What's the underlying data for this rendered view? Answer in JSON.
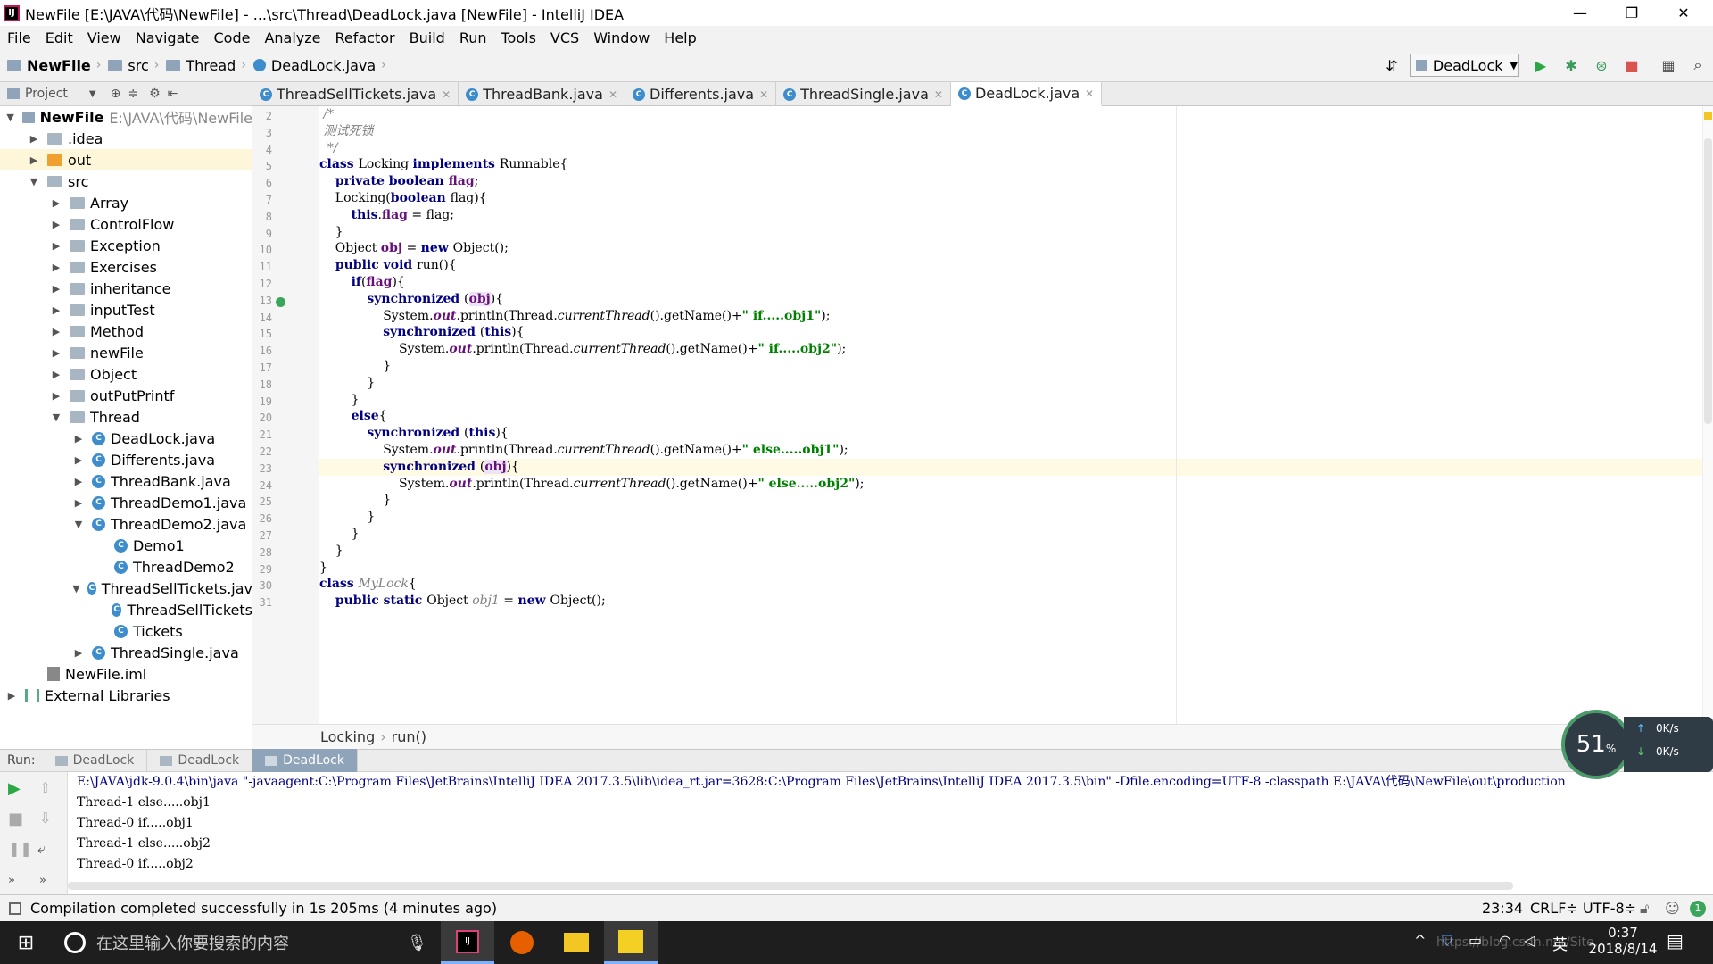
{
  "window": {
    "title": "NewFile [E:\\JAVA\\代码\\NewFile] - ...\\src\\Thread\\DeadLock.java [NewFile] - IntelliJ IDEA",
    "app_icon": "IJ"
  },
  "window_controls": {
    "minimize": "—",
    "restore": "❐",
    "close": "✕"
  },
  "menu": [
    "File",
    "Edit",
    "View",
    "Navigate",
    "Code",
    "Analyze",
    "Refactor",
    "Build",
    "Run",
    "Tools",
    "VCS",
    "Window",
    "Help"
  ],
  "breadcrumb": [
    "NewFile",
    "src",
    "Thread",
    "DeadLock.java"
  ],
  "run_config": "DeadLock",
  "project_panel": {
    "label": "Project"
  },
  "tabs": [
    {
      "label": "ThreadSellTickets.java",
      "active": false
    },
    {
      "label": "ThreadBank.java",
      "active": false
    },
    {
      "label": "Differents.java",
      "active": false
    },
    {
      "label": "ThreadSingle.java",
      "active": false
    },
    {
      "label": "DeadLock.java",
      "active": true
    }
  ],
  "tree": [
    {
      "label": "NewFile",
      "extra": "E:\\JAVA\\代码\\NewFile",
      "depth": 0,
      "arrow": "▼",
      "icon": "root",
      "bold": true
    },
    {
      "label": ".idea",
      "depth": 1,
      "arrow": "▶",
      "icon": "folder"
    },
    {
      "label": "out",
      "depth": 1,
      "arrow": "▶",
      "icon": "out",
      "selected": true
    },
    {
      "label": "src",
      "depth": 1,
      "arrow": "▼",
      "icon": "folder"
    },
    {
      "label": "Array",
      "depth": 2,
      "arrow": "▶",
      "icon": "folder"
    },
    {
      "label": "ControlFlow",
      "depth": 2,
      "arrow": "▶",
      "icon": "folder"
    },
    {
      "label": "Exception",
      "depth": 2,
      "arrow": "▶",
      "icon": "folder"
    },
    {
      "label": "Exercises",
      "depth": 2,
      "arrow": "▶",
      "icon": "folder"
    },
    {
      "label": "inheritance",
      "depth": 2,
      "arrow": "▶",
      "icon": "folder"
    },
    {
      "label": "inputTest",
      "depth": 2,
      "arrow": "▶",
      "icon": "folder"
    },
    {
      "label": "Method",
      "depth": 2,
      "arrow": "▶",
      "icon": "folder"
    },
    {
      "label": "newFile",
      "depth": 2,
      "arrow": "▶",
      "icon": "folder"
    },
    {
      "label": "Object",
      "depth": 2,
      "arrow": "▶",
      "icon": "folder"
    },
    {
      "label": "outPutPrintf",
      "depth": 2,
      "arrow": "▶",
      "icon": "folder"
    },
    {
      "label": "Thread",
      "depth": 2,
      "arrow": "▼",
      "icon": "folder"
    },
    {
      "label": "DeadLock.java",
      "depth": 3,
      "arrow": "▶",
      "icon": "class"
    },
    {
      "label": "Differents.java",
      "depth": 3,
      "arrow": "▶",
      "icon": "class"
    },
    {
      "label": "ThreadBank.java",
      "depth": 3,
      "arrow": "▶",
      "icon": "class"
    },
    {
      "label": "ThreadDemo1.java",
      "depth": 3,
      "arrow": "▶",
      "icon": "class"
    },
    {
      "label": "ThreadDemo2.java",
      "depth": 3,
      "arrow": "▼",
      "icon": "class"
    },
    {
      "label": "Demo1",
      "depth": 4,
      "arrow": "",
      "icon": "class"
    },
    {
      "label": "ThreadDemo2",
      "depth": 4,
      "arrow": "",
      "icon": "class"
    },
    {
      "label": "ThreadSellTickets.jav",
      "depth": 3,
      "arrow": "▼",
      "icon": "class"
    },
    {
      "label": "ThreadSellTickets",
      "depth": 4,
      "arrow": "",
      "icon": "class"
    },
    {
      "label": "Tickets",
      "depth": 4,
      "arrow": "",
      "icon": "class"
    },
    {
      "label": "ThreadSingle.java",
      "depth": 3,
      "arrow": "▶",
      "icon": "class"
    },
    {
      "label": "NewFile.iml",
      "depth": 1,
      "arrow": "",
      "icon": "iml"
    },
    {
      "label": "External Libraries",
      "depth": 0,
      "arrow": "▶",
      "icon": "libs"
    }
  ],
  "line_numbers": [
    "2",
    "3",
    "4",
    "5",
    "6",
    "7",
    "8",
    "9",
    "10",
    "11",
    "12",
    "13",
    "14",
    "15",
    "16",
    "17",
    "18",
    "19",
    "20",
    "21",
    "22",
    "23",
    "24",
    "25",
    "26",
    "27",
    "28",
    "29",
    "30",
    "31"
  ],
  "code": [
    [
      {
        "t": " /*",
        "c": "cmt"
      }
    ],
    [
      {
        "t": " 测试死锁",
        "c": "cmt"
      }
    ],
    [
      {
        "t": "  */",
        "c": "cmt"
      }
    ],
    [
      {
        "t": "class ",
        "c": "kw"
      },
      {
        "t": "Locking "
      },
      {
        "t": "implements ",
        "c": "kw"
      },
      {
        "t": "Runnable{"
      }
    ],
    [
      {
        "t": "    "
      },
      {
        "t": "private boolean ",
        "c": "kw"
      },
      {
        "t": "flag",
        "c": "fieldc"
      },
      {
        "t": ";"
      }
    ],
    [
      {
        "t": "    Locking("
      },
      {
        "t": "boolean ",
        "c": "kw"
      },
      {
        "t": "flag){"
      }
    ],
    [
      {
        "t": "        "
      },
      {
        "t": "this",
        "c": "kw"
      },
      {
        "t": "."
      },
      {
        "t": "flag",
        "c": "fieldc"
      },
      {
        "t": " = flag;"
      }
    ],
    [
      {
        "t": "    }"
      }
    ],
    [
      {
        "t": "    Object "
      },
      {
        "t": "obj",
        "c": "fieldc"
      },
      {
        "t": " = "
      },
      {
        "t": "new ",
        "c": "kw"
      },
      {
        "t": "Object();"
      }
    ],
    [
      {
        "t": "    "
      },
      {
        "t": "public void ",
        "c": "kw"
      },
      {
        "t": "run(){"
      }
    ],
    [
      {
        "t": "        "
      },
      {
        "t": "if",
        "c": "kw"
      },
      {
        "t": "("
      },
      {
        "t": "flag",
        "c": "fieldc"
      },
      {
        "t": "){"
      }
    ],
    [
      {
        "t": "            "
      },
      {
        "t": "synchronized ",
        "c": "kw"
      },
      {
        "t": "("
      },
      {
        "t": "obj",
        "c": "fieldc ob"
      },
      {
        "t": "){"
      }
    ],
    [
      {
        "t": "                System."
      },
      {
        "t": "out",
        "c": "stat"
      },
      {
        "t": ".println(Thread."
      },
      {
        "t": "currentThread",
        "c": "itl"
      },
      {
        "t": "().getName()+"
      },
      {
        "t": "\" if.....obj1\"",
        "c": "str"
      },
      {
        "t": ");"
      }
    ],
    [
      {
        "t": "                "
      },
      {
        "t": "synchronized ",
        "c": "kw"
      },
      {
        "t": "("
      },
      {
        "t": "this",
        "c": "kw"
      },
      {
        "t": "){"
      }
    ],
    [
      {
        "t": "                    System."
      },
      {
        "t": "out",
        "c": "stat"
      },
      {
        "t": ".println(Thread."
      },
      {
        "t": "currentThread",
        "c": "itl"
      },
      {
        "t": "().getName()+"
      },
      {
        "t": "\" if.....obj2\"",
        "c": "str"
      },
      {
        "t": ");"
      }
    ],
    [
      {
        "t": "                }"
      }
    ],
    [
      {
        "t": "            }"
      }
    ],
    [
      {
        "t": "        }"
      }
    ],
    [
      {
        "t": "        "
      },
      {
        "t": "else",
        "c": "kw"
      },
      {
        "t": "{"
      }
    ],
    [
      {
        "t": "            "
      },
      {
        "t": "synchronized ",
        "c": "kw"
      },
      {
        "t": "("
      },
      {
        "t": "this",
        "c": "kw"
      },
      {
        "t": "){"
      }
    ],
    [
      {
        "t": "                System."
      },
      {
        "t": "out",
        "c": "stat"
      },
      {
        "t": ".println(Thread."
      },
      {
        "t": "currentThread",
        "c": "itl"
      },
      {
        "t": "().getName()+"
      },
      {
        "t": "\" else.....obj1\"",
        "c": "str"
      },
      {
        "t": ");"
      }
    ],
    [
      {
        "t": "                "
      },
      {
        "t": "synchronized ",
        "c": "kw"
      },
      {
        "t": "("
      },
      {
        "t": "obj",
        "c": "fieldc ob"
      },
      {
        "t": "){"
      }
    ],
    [
      {
        "t": "                    System."
      },
      {
        "t": "out",
        "c": "stat"
      },
      {
        "t": ".println(Thread."
      },
      {
        "t": "currentThread",
        "c": "itl"
      },
      {
        "t": "().getName()+"
      },
      {
        "t": "\" else.....obj2\"",
        "c": "str"
      },
      {
        "t": ");"
      }
    ],
    [
      {
        "t": "                }"
      }
    ],
    [
      {
        "t": "            }"
      }
    ],
    [
      {
        "t": "        }"
      }
    ],
    [
      {
        "t": "    }"
      }
    ],
    [
      {
        "t": "}"
      }
    ],
    [
      {
        "t": "class ",
        "c": "kw"
      },
      {
        "t": "MyLock",
        "c": "cmt"
      },
      {
        "t": "{"
      }
    ],
    [
      {
        "t": "    "
      },
      {
        "t": "public static ",
        "c": "kw"
      },
      {
        "t": "Object "
      },
      {
        "t": "obj1",
        "c": "cmt"
      },
      {
        "t": " = "
      },
      {
        "t": "new ",
        "c": "kw"
      },
      {
        "t": "Object();"
      }
    ]
  ],
  "current_line_index": 21,
  "editor_breadcrumb": [
    "Locking",
    "run()"
  ],
  "run_panel": {
    "label": "Run:",
    "tabs": [
      {
        "label": "DeadLock",
        "active": false
      },
      {
        "label": "DeadLock",
        "active": false
      },
      {
        "label": "DeadLock",
        "active": true
      }
    ]
  },
  "console": [
    {
      "text": "E:\\JAVA\\jdk-9.0.4\\bin\\java \"-javaagent:C:\\Program Files\\JetBrains\\IntelliJ IDEA 2017.3.5\\lib\\idea_rt.jar=3628:C:\\Program Files\\JetBrains\\IntelliJ IDEA 2017.3.5\\bin\" -Dfile.encoding=UTF-8 -classpath E:\\JAVA\\代码\\NewFile\\out\\production",
      "cmd": true
    },
    {
      "text": "Thread-1 else.....obj1"
    },
    {
      "text": "Thread-0 if.....obj1"
    },
    {
      "text": "Thread-1 else.....obj2"
    },
    {
      "text": "Thread-0 if.....obj2"
    }
  ],
  "perf_widget": {
    "percent": "51",
    "unit": "%",
    "up": "0K/s",
    "down": "0K/s"
  },
  "status": {
    "message": "Compilation completed successfully in 1s 205ms (4 minutes ago)",
    "position": "23:34",
    "line_sep": "CRLF≑",
    "encoding": "UTF-8≑"
  },
  "taskbar": {
    "search_placeholder": "在这里输入你要搜索的内容",
    "ime": "英",
    "time": "0:37",
    "date": "2018/8/14",
    "watermark": "https://blog.csdn.net/Site..."
  },
  "colors": {
    "accent": "#3d8dcc",
    "keyword": "#000080",
    "string": "#008000",
    "field": "#660e7a"
  }
}
